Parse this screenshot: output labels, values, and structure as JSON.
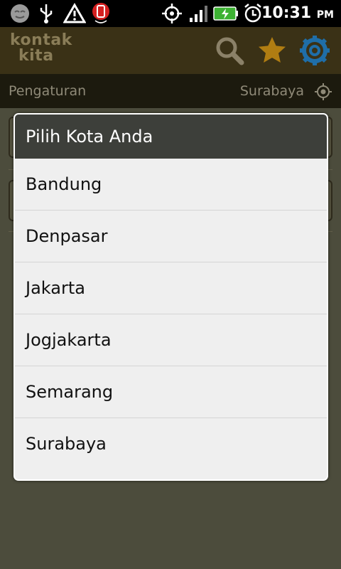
{
  "status_bar": {
    "time": "10:31",
    "ampm": "PM"
  },
  "app": {
    "logo_line1": "kontak",
    "logo_line2": "kita"
  },
  "subbar": {
    "left_label": "Pengaturan",
    "location": "Surabaya"
  },
  "dialog": {
    "title": "Pilih Kota Anda",
    "options": [
      "Bandung",
      "Denpasar",
      "Jakarta",
      "Jogjakarta",
      "Semarang",
      "Surabaya"
    ]
  },
  "colors": {
    "appbar": "#3a3116",
    "dialog_title_bg": "#3d3f3a",
    "dialog_bg": "#efefef",
    "accent_star": "#b07d12",
    "accent_gear": "#1f6ea8"
  }
}
